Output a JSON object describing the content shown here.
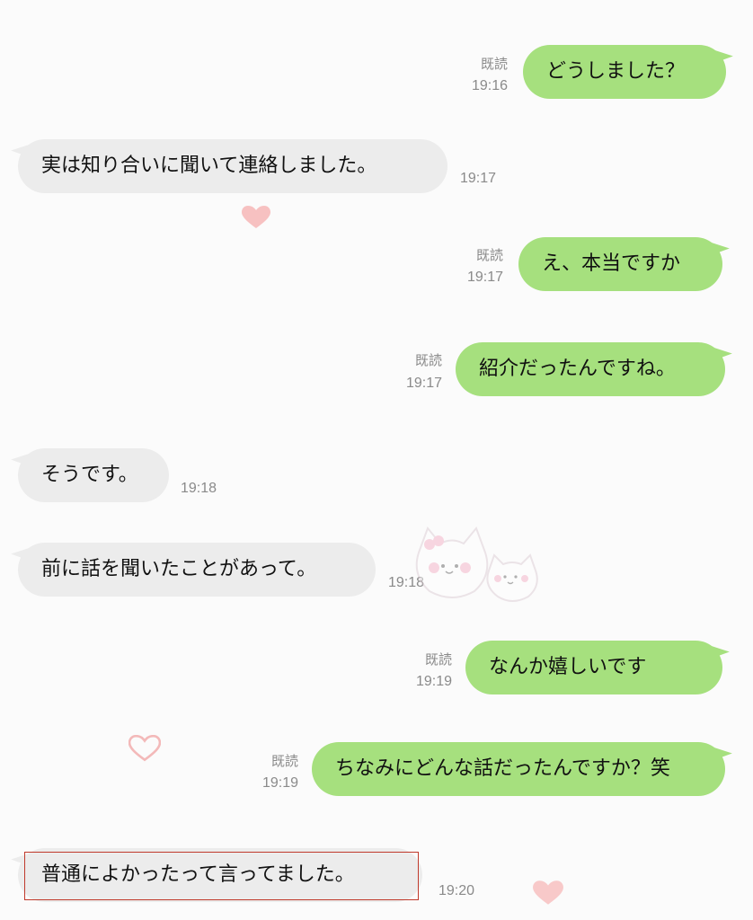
{
  "messages": [
    {
      "id": "m1",
      "side": "out",
      "text": "どうしました？",
      "read": "既読",
      "time": "19:16"
    },
    {
      "id": "m2",
      "side": "in",
      "text": "実は知り合いに聞いて連絡しました。",
      "time": "19:17"
    },
    {
      "id": "m3",
      "side": "out",
      "text": "え、本当ですか",
      "read": "既読",
      "time": "19:17"
    },
    {
      "id": "m4",
      "side": "out",
      "text": "紹介だったんですね。",
      "read": "既読",
      "time": "19:17"
    },
    {
      "id": "m5",
      "side": "in",
      "text": "そうです。",
      "time": "19:18"
    },
    {
      "id": "m6",
      "side": "in",
      "text": "前に話を聞いたことがあって。",
      "time": "19:18"
    },
    {
      "id": "m7",
      "side": "out",
      "text": "なんか嬉しいです",
      "read": "既読",
      "time": "19:19"
    },
    {
      "id": "m8",
      "side": "out",
      "text": "ちなみにどんな話だったんですか？笑",
      "read": "既読",
      "time": "19:19"
    },
    {
      "id": "m9",
      "side": "in",
      "text": "普通によかったって言ってました。",
      "time": "19:20",
      "highlighted": true
    }
  ],
  "colors": {
    "outgoing_bubble": "#a6e07e",
    "incoming_bubble": "#ececec",
    "highlight_border": "#c0392b",
    "heart": "#f4a6a6"
  },
  "decorations": [
    "heart-icon",
    "cat-sticker-icon"
  ]
}
